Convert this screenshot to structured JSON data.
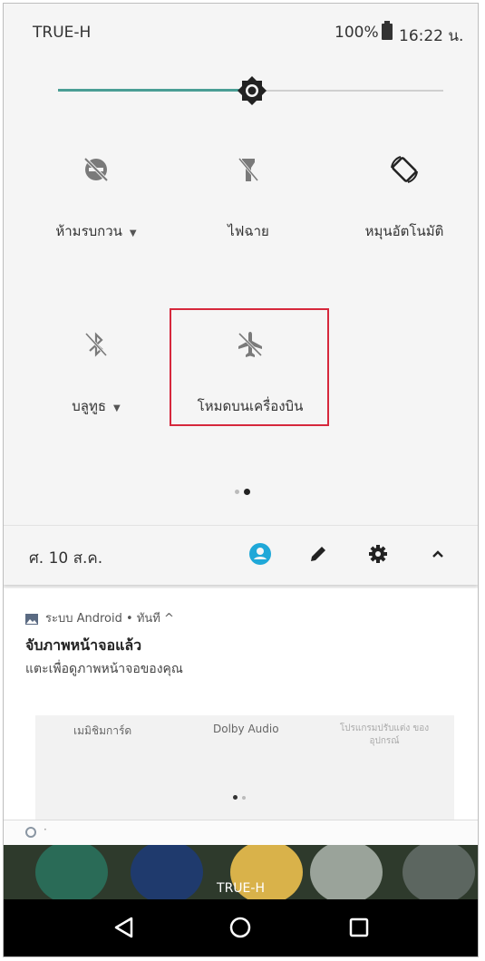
{
  "status_bar": {
    "carrier": "TRUE-H",
    "battery": "100%",
    "time": "16:22 น."
  },
  "brightness": {
    "level": 0.5
  },
  "tiles": [
    {
      "label": "ห้ามรบกวน",
      "icon": "do-not-disturb-off-icon",
      "has_dropdown": true
    },
    {
      "label": "ไฟฉาย",
      "icon": "flashlight-off-icon",
      "has_dropdown": false
    },
    {
      "label": "หมุนอัตโนมัติ",
      "icon": "auto-rotate-icon",
      "has_dropdown": false
    },
    {
      "label": "บลูทูธ",
      "icon": "bluetooth-off-icon",
      "has_dropdown": true
    },
    {
      "label": "โหมดบนเครื่องบิน",
      "icon": "airplane-mode-off-icon",
      "has_dropdown": false
    }
  ],
  "tile_pages": {
    "count": 2,
    "current": 2
  },
  "date_row": {
    "date": "ศ. 10 ส.ค."
  },
  "notification": {
    "app": "ระบบ Android",
    "time": "ทันที",
    "title": "จับภาพหน้าจอแล้ว",
    "body": "แตะเพื่อดูภาพหน้าจอของคุณ"
  },
  "preview": {
    "items": [
      "เมมิชิมการ์ด",
      "Dolby Audio",
      "โปรแกรมปรับแต่ง ของอุปกรณ์"
    ]
  },
  "home_label": "TRUE-H",
  "colors": {
    "accent": "#4a9e95",
    "highlight": "#d6283c",
    "account": "#1fa8d8"
  }
}
